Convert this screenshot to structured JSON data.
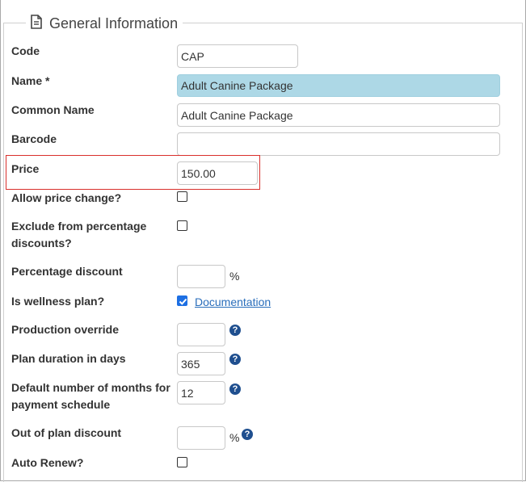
{
  "section": {
    "title": "General Information",
    "icon": "document-icon"
  },
  "fields": {
    "code": {
      "label": "Code",
      "value": "CAP"
    },
    "name": {
      "label": "Name *",
      "value": "Adult Canine Package"
    },
    "common_name": {
      "label": "Common Name",
      "value": "Adult Canine Package"
    },
    "barcode": {
      "label": "Barcode",
      "value": ""
    },
    "price": {
      "label": "Price",
      "value": "150.00"
    },
    "allow_price_change": {
      "label": "Allow price change?",
      "checked": false
    },
    "exclude_discounts": {
      "label_line1": "Exclude from percentage",
      "label_line2": "discounts?",
      "checked": false
    },
    "percentage_discount": {
      "label": "Percentage discount",
      "value": "",
      "suffix": "%"
    },
    "is_wellness_plan": {
      "label": "Is wellness plan?",
      "checked": true,
      "link": "Documentation"
    },
    "production_override": {
      "label": "Production override",
      "value": "",
      "help": "?"
    },
    "plan_duration": {
      "label": "Plan duration in days",
      "value": "365",
      "help": "?"
    },
    "default_months": {
      "label_line1": "Default number of months for",
      "label_line2": "payment schedule",
      "value": "12",
      "help": "?"
    },
    "out_of_plan_discount": {
      "label": "Out of plan discount",
      "value": "",
      "suffix": "%",
      "help": "?"
    },
    "auto_renew": {
      "label": "Auto Renew?",
      "checked": false
    }
  }
}
